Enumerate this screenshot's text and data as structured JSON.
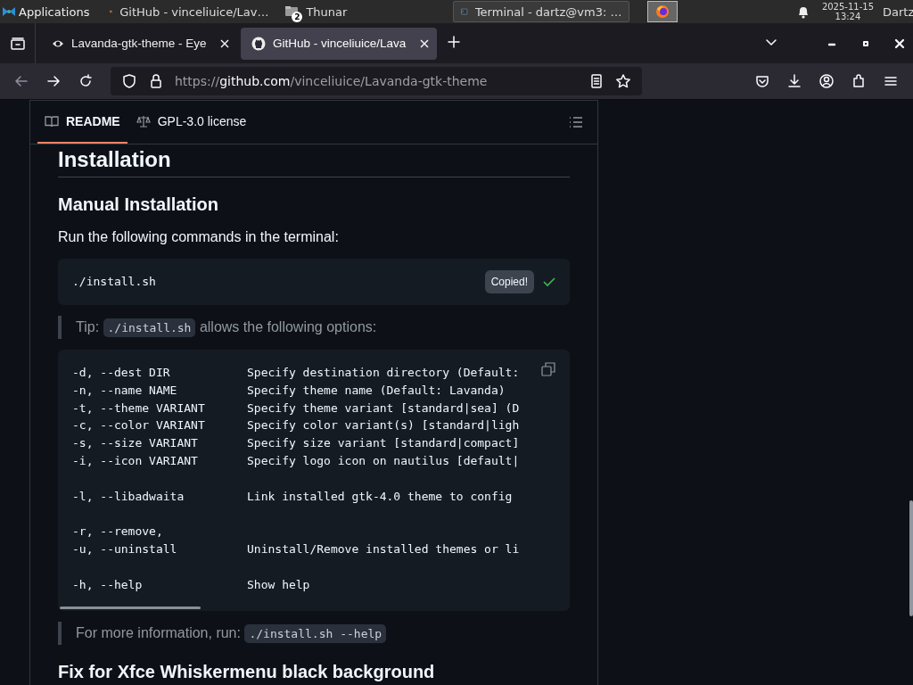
{
  "taskbar": {
    "apps_menu": "Applications",
    "windows": [
      {
        "title": "GitHub - vinceliuice/Lav…",
        "selected": false
      },
      {
        "title": "Thunar",
        "badge": "2",
        "selected": false
      },
      {
        "title": "Terminal - dartz@vm3: …",
        "selected": true
      }
    ],
    "date": "2025-11-15",
    "time": "13:24",
    "user": "Dartz"
  },
  "browser": {
    "tabs": [
      {
        "title": "Lavanda-gtk-theme - Eye",
        "selected": false
      },
      {
        "title": "GitHub - vinceliuice/Lava",
        "selected": true
      }
    ],
    "url": {
      "scheme": "https://",
      "host": "github.com",
      "path": "/vinceliuice/Lavanda-gtk-theme"
    }
  },
  "readme": {
    "tabs": [
      {
        "label": "README",
        "selected": true
      },
      {
        "label": "GPL-3.0 license",
        "selected": false
      }
    ],
    "heading": "Installation",
    "subheading": "Manual Installation",
    "intro": "Run the following commands in the terminal:",
    "command": "./install.sh",
    "copy_tooltip": "Copied!",
    "tip": {
      "before": "Tip: ",
      "code": "./install.sh",
      "after": " allows the following options:"
    },
    "options": [
      [
        {
          "option": "-d, --dest DIR",
          "description": "Specify destination directory (Default:"
        },
        {
          "option": "-n, --name NAME",
          "description": "Specify theme name (Default: Lavanda)"
        },
        {
          "option": "-t, --theme VARIANT",
          "description": "Specify theme variant [standard|sea] (D"
        },
        {
          "option": "-c, --color VARIANT",
          "description": "Specify color variant(s) [standard|ligh"
        },
        {
          "option": "-s, --size VARIANT",
          "description": "Specify size variant [standard|compact]"
        },
        {
          "option": "-i, --icon VARIANT",
          "description": "Specify logo icon on nautilus [default|"
        }
      ],
      [
        {
          "option": "-l, --libadwaita",
          "description": "Link installed gtk-4.0 theme to config"
        }
      ],
      [
        {
          "option": "-r, --remove,"
        },
        {
          "option": "-u, --uninstall",
          "description": "Uninstall/Remove installed themes or li"
        }
      ],
      [
        {
          "option": "-h, --help",
          "description": "Show help"
        }
      ]
    ],
    "more": {
      "before": "For more information, run: ",
      "code": "./install.sh --help"
    },
    "next_heading": "Fix for Xfce Whiskermenu black background"
  }
}
